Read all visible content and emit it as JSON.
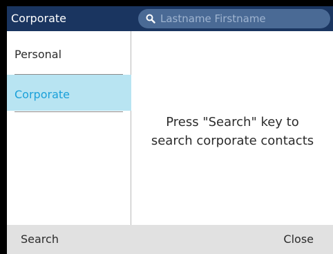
{
  "header": {
    "title": "Corporate",
    "search": {
      "placeholder": "Lastname Firstname",
      "icon": "search-icon"
    }
  },
  "sidebar": {
    "items": [
      {
        "label": "Personal",
        "selected": false
      },
      {
        "label": "Corporate",
        "selected": true
      }
    ]
  },
  "main": {
    "message_line1": "Press \"Search\" key to",
    "message_line2": "search corporate contacts"
  },
  "softkeys": {
    "left": "Search",
    "right": "Close"
  },
  "colors": {
    "header_bg": "#1a3560",
    "search_bg": "#4a6a95",
    "selected_bg": "#b8e4f2",
    "selected_text": "#1aa0d9",
    "softkey_bg": "#e1e1e1"
  }
}
